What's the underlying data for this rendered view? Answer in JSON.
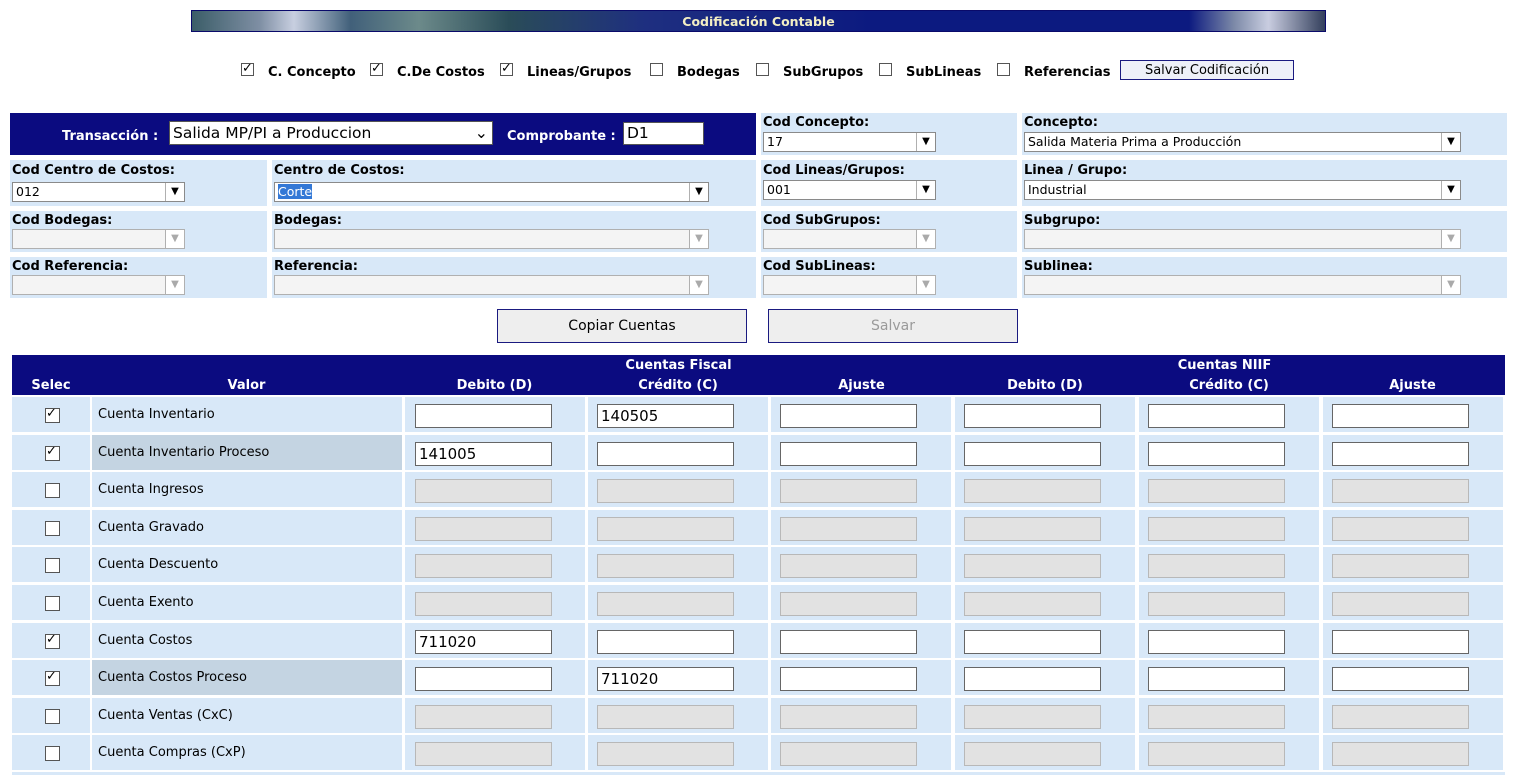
{
  "banner": {
    "title": "Codificación Contable"
  },
  "top_options": [
    {
      "label": "C. Concepto",
      "checked": true
    },
    {
      "label": "C.De Costos",
      "checked": true
    },
    {
      "label": "Lineas/Grupos",
      "checked": true
    },
    {
      "label": "Bodegas",
      "checked": false
    },
    {
      "label": "SubGrupos",
      "checked": false
    },
    {
      "label": "SubLineas",
      "checked": false
    },
    {
      "label": "Referencias",
      "checked": false
    }
  ],
  "salvar_codificacion": "Salvar Codificación",
  "transaccion": {
    "label": "Transacción :",
    "value": "Salida MP/PI a Produccion"
  },
  "comprobante": {
    "label": "Comprobante :",
    "value": "D1"
  },
  "fields": {
    "cod_concepto": {
      "label": "Cod Concepto:",
      "value": "17"
    },
    "concepto": {
      "label": "Concepto:",
      "value": "Salida Materia Prima a Producción"
    },
    "cod_centro_costos": {
      "label": "Cod Centro de Costos:",
      "value": "012"
    },
    "centro_costos": {
      "label": "Centro de Costos:",
      "value": "Corte"
    },
    "cod_lineas_grupos": {
      "label": "Cod Lineas/Grupos:",
      "value": "001"
    },
    "linea_grupo": {
      "label": "Linea / Grupo:",
      "value": "Industrial"
    },
    "cod_bodegas": {
      "label": "Cod Bodegas:",
      "value": ""
    },
    "bodegas": {
      "label": "Bodegas:",
      "value": ""
    },
    "cod_subgrupos": {
      "label": "Cod SubGrupos:",
      "value": ""
    },
    "subgrupo": {
      "label": "Subgrupo:",
      "value": ""
    },
    "cod_referencia": {
      "label": "Cod Referencia:",
      "value": ""
    },
    "referencia": {
      "label": "Referencia:",
      "value": ""
    },
    "cod_sublineas": {
      "label": "Cod SubLineas:",
      "value": ""
    },
    "sublinea": {
      "label": "Sublinea:",
      "value": ""
    }
  },
  "buttons": {
    "copiar": "Copiar Cuentas",
    "salvar": "Salvar"
  },
  "table": {
    "group_fiscal": "Cuentas Fiscal",
    "group_niif": "Cuentas NIIF",
    "headers": [
      "Selec",
      "Valor",
      "Debito (D)",
      "Crédito (C)",
      "Ajuste",
      "Debito (D)",
      "Crédito (C)",
      "Ajuste"
    ],
    "rows": [
      {
        "label": "Cuenta Inventario",
        "checked": true,
        "values": [
          "",
          "140505",
          "",
          "",
          "",
          ""
        ]
      },
      {
        "label": "Cuenta Inventario Proceso",
        "checked": true,
        "values": [
          "141005",
          "",
          "",
          "",
          "",
          ""
        ]
      },
      {
        "label": "Cuenta Ingresos",
        "checked": false,
        "values": [
          "",
          "",
          "",
          "",
          "",
          ""
        ]
      },
      {
        "label": "Cuenta Gravado",
        "checked": false,
        "values": [
          "",
          "",
          "",
          "",
          "",
          ""
        ]
      },
      {
        "label": "Cuenta Descuento",
        "checked": false,
        "values": [
          "",
          "",
          "",
          "",
          "",
          ""
        ]
      },
      {
        "label": "Cuenta Exento",
        "checked": false,
        "values": [
          "",
          "",
          "",
          "",
          "",
          ""
        ]
      },
      {
        "label": "Cuenta Costos",
        "checked": true,
        "values": [
          "711020",
          "",
          "",
          "",
          "",
          ""
        ]
      },
      {
        "label": "Cuenta Costos Proceso",
        "checked": true,
        "values": [
          "",
          "711020",
          "",
          "",
          "",
          ""
        ]
      },
      {
        "label": "Cuenta Ventas (CxC)",
        "checked": false,
        "values": [
          "",
          "",
          "",
          "",
          "",
          ""
        ]
      },
      {
        "label": "Cuenta Compras (CxP)",
        "checked": false,
        "values": [
          "",
          "",
          "",
          "",
          "",
          ""
        ]
      }
    ]
  },
  "colors": {
    "navy": "#0b0b80",
    "panel": "#d8e8f8",
    "banner_text": "#f3efc4"
  }
}
